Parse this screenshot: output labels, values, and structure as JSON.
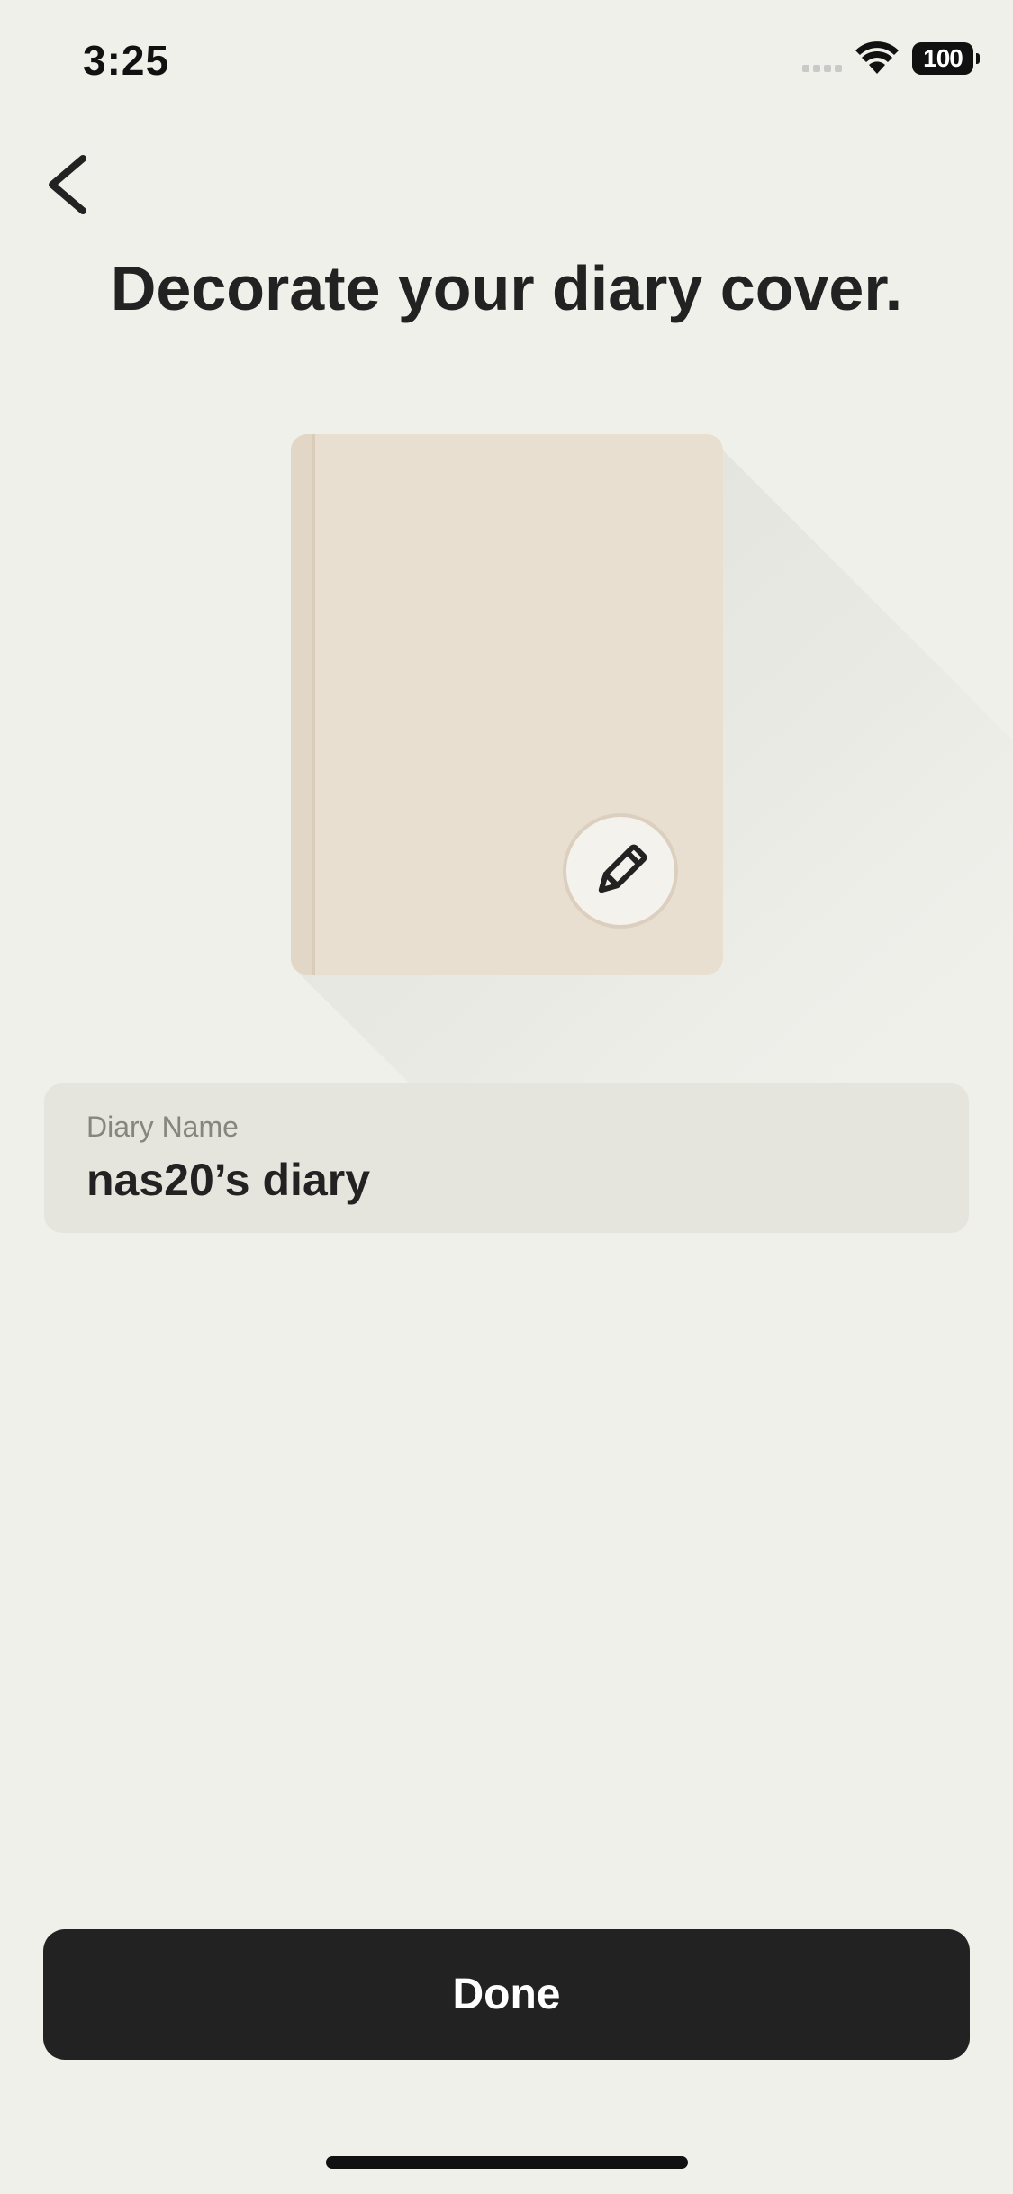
{
  "status_bar": {
    "time": "3:25",
    "battery": "100"
  },
  "header": {
    "back_icon": "chevron-left-icon",
    "title": "Decorate your diary cover."
  },
  "cover": {
    "color": "#e8dfd0",
    "edit_icon": "pencil-icon"
  },
  "diary_name": {
    "label": "Diary Name",
    "value": "nas20’s diary"
  },
  "done_label": "Done",
  "colors": {
    "background": "#f0f0eb",
    "cover": "#e8dfd0",
    "button": "#222222",
    "field": "#e5e4dd"
  }
}
